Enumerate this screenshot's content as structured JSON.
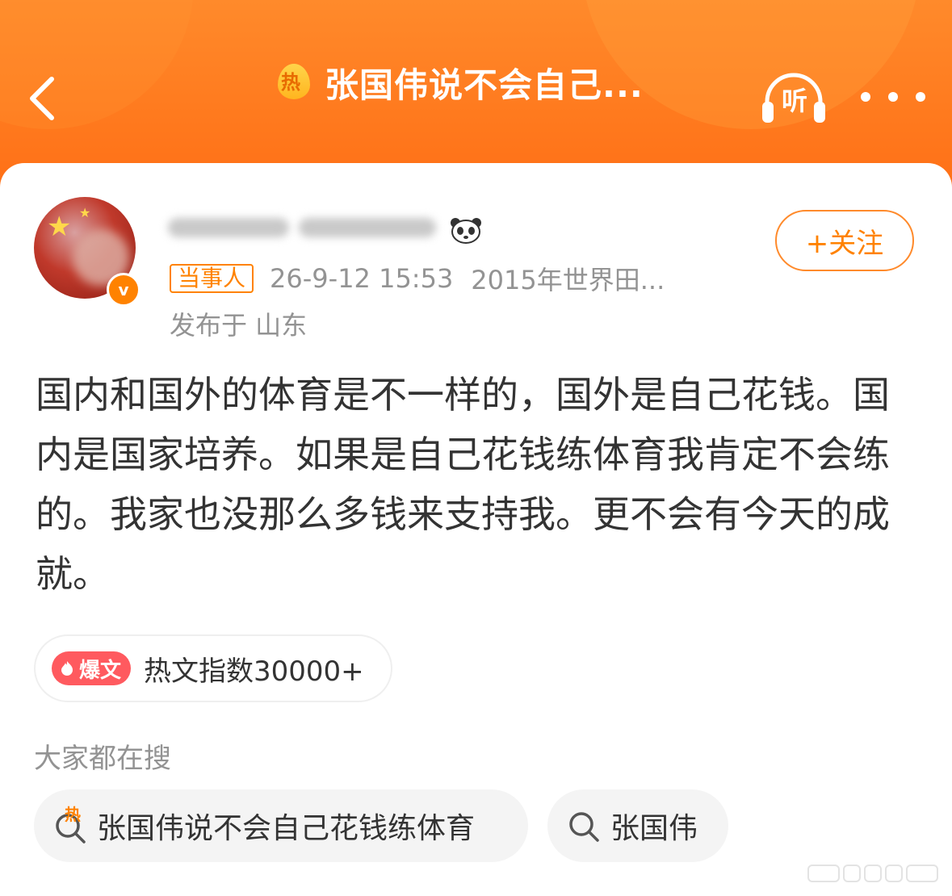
{
  "header": {
    "title": "张国伟说不会自己...",
    "hot_badge": "热",
    "listen_label": "听",
    "back_icon": "chevron-left-icon",
    "more_icon": "more-dots-icon"
  },
  "author": {
    "role_tag": "当事人",
    "time": "26-9-12 15:53",
    "source": "2015年世界田...",
    "location": "发布于 山东",
    "follow_label": "+关注",
    "verified_badge": "v"
  },
  "post": {
    "text": "国内和国外的体育是不一样的，国外是自己花钱。国内是国家培养。如果是自己花钱练体育我肯定不会练的。我家也没那么多钱来支持我。更不会有今天的成就。"
  },
  "hot_post": {
    "tag": "爆文",
    "index_text": "热文指数30000+"
  },
  "search": {
    "title": "大家都在搜",
    "chips": [
      {
        "text": "张国伟说不会自己花钱练体育",
        "hot": "热"
      },
      {
        "text": "张国伟"
      }
    ]
  },
  "colors": {
    "brand_orange": "#ff7b1f",
    "accent": "#ff8200",
    "text_primary": "#333333",
    "text_secondary": "#939393",
    "boom_red": "#ff5a5f"
  }
}
